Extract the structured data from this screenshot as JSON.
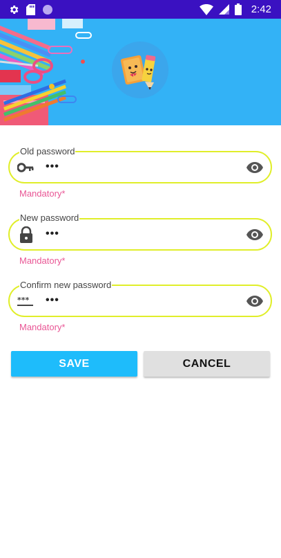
{
  "status_bar": {
    "time": "2:42",
    "icons": [
      "gear-icon",
      "sd-card-icon",
      "circle-app-icon",
      "wifi-icon",
      "signal-icon",
      "battery-icon"
    ]
  },
  "header": {
    "background_color": "#33b2f6",
    "logo_icon": "notebook-pencil-logo-icon"
  },
  "form": {
    "old_password": {
      "label": "Old password",
      "value": "•••",
      "helper": "Mandatory*",
      "icon": "key-icon"
    },
    "new_password": {
      "label": "New password",
      "value": "•••",
      "helper": "Mandatory*",
      "icon": "lock-icon"
    },
    "confirm_password": {
      "label": "Confirm new password",
      "value": "•••",
      "helper": "Mandatory*",
      "icon": "password-icon"
    }
  },
  "buttons": {
    "save_label": "SAVE",
    "cancel_label": "CANCEL"
  },
  "colors": {
    "status_bar": "#3a11c1",
    "field_border": "#e0ee29",
    "helper_text": "#e95695",
    "save_button": "#1ebcfb",
    "cancel_button": "#e0e0e0"
  }
}
